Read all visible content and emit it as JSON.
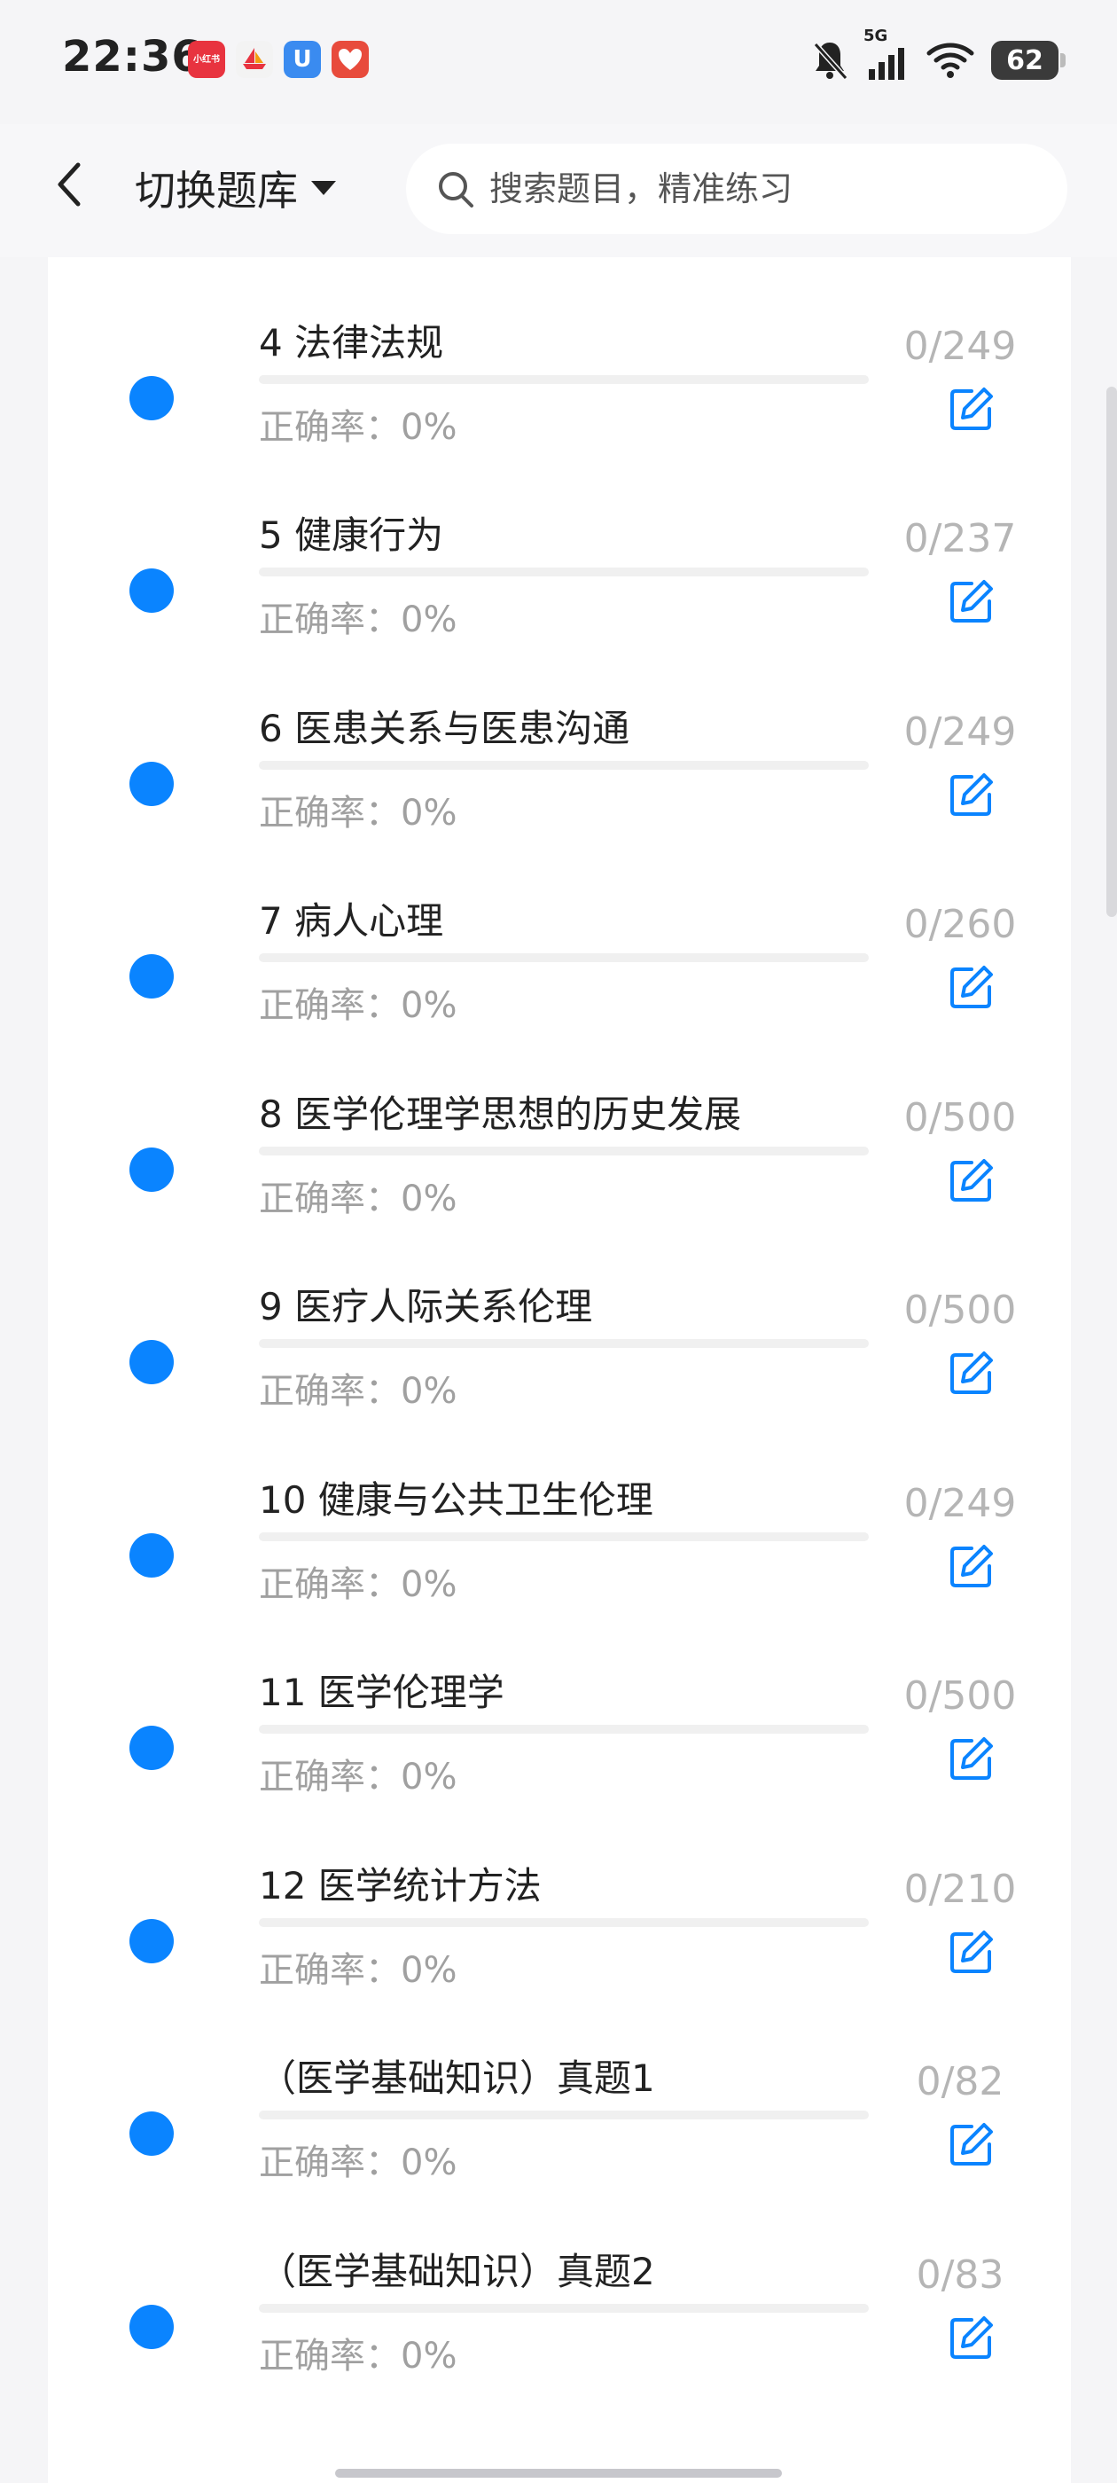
{
  "status_bar": {
    "time": "22:36",
    "apps": [
      {
        "icon": "xiaohongshu-icon",
        "label": "小红书",
        "color": "#e8333f"
      },
      {
        "icon": "boat-app-icon",
        "label": "",
        "color": "#f3f3f3"
      },
      {
        "icon": "u-app-icon",
        "label": "U",
        "color": "#3a8bf0"
      },
      {
        "icon": "heart-app-icon",
        "label": "",
        "color": "#e84b3c"
      }
    ],
    "signal_label": "5G",
    "battery": "62"
  },
  "header": {
    "back_icon": "chevron-left-icon",
    "switch_label": "切换题库",
    "search_placeholder": "搜索题目，精准练习"
  },
  "list": {
    "items": [
      {
        "title": "",
        "rate_label": "正确率：0%",
        "count": "",
        "progress": 0
      },
      {
        "title": "4 法律法规",
        "rate_label": "正确率：0%",
        "count": "0/249",
        "progress": 0
      },
      {
        "title": "5 健康行为",
        "rate_label": "正确率：0%",
        "count": "0/237",
        "progress": 0
      },
      {
        "title": "6 医患关系与医患沟通",
        "rate_label": "正确率：0%",
        "count": "0/249",
        "progress": 0
      },
      {
        "title": "7 病人心理",
        "rate_label": "正确率：0%",
        "count": "0/260",
        "progress": 0
      },
      {
        "title": "8 医学伦理学思想的历史发展",
        "rate_label": "正确率：0%",
        "count": "0/500",
        "progress": 0
      },
      {
        "title": "9 医疗人际关系伦理",
        "rate_label": "正确率：0%",
        "count": "0/500",
        "progress": 0
      },
      {
        "title": "10 健康与公共卫生伦理",
        "rate_label": "正确率：0%",
        "count": "0/249",
        "progress": 0
      },
      {
        "title": "11 医学伦理学",
        "rate_label": "正确率：0%",
        "count": "0/500",
        "progress": 0
      },
      {
        "title": "12 医学统计方法",
        "rate_label": "正确率：0%",
        "count": "0/210",
        "progress": 0
      },
      {
        "title": "（医学基础知识）真题1",
        "rate_label": "正确率：0%",
        "count": "0/82",
        "progress": 0
      },
      {
        "title": "（医学基础知识）真题2",
        "rate_label": "正确率：0%",
        "count": "0/83",
        "progress": 0
      }
    ]
  },
  "colors": {
    "accent": "#0a84ff",
    "muted_text": "#a0a0a0"
  }
}
